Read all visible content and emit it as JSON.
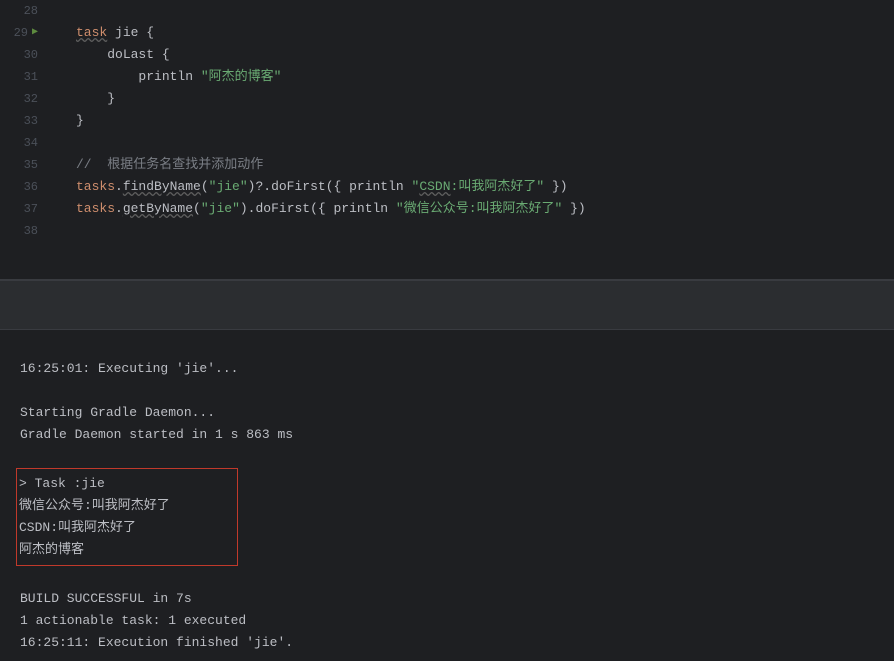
{
  "editor": {
    "lines": [
      {
        "num": "28",
        "content": ""
      },
      {
        "num": "29",
        "content": "task_jie",
        "hasRun": true
      },
      {
        "num": "30",
        "content": "doLast"
      },
      {
        "num": "31",
        "content": "println_blog"
      },
      {
        "num": "32",
        "content": "close_brace1"
      },
      {
        "num": "33",
        "content": "close_brace2"
      },
      {
        "num": "34",
        "content": ""
      },
      {
        "num": "35",
        "content": "comment"
      },
      {
        "num": "36",
        "content": "findByName"
      },
      {
        "num": "37",
        "content": "getByName"
      },
      {
        "num": "38",
        "content": ""
      }
    ],
    "tokens": {
      "task": "task",
      "jie": "jie",
      "doLast": "doLast",
      "println": "println",
      "blog_string": "\"阿杰的博客\"",
      "comment_text": "//  根据任务名查找并添加动作",
      "tasks": "tasks",
      "findByName": "findByName",
      "getByName": "getByName",
      "jie_string": "\"jie\"",
      "doFirst": "doFirst",
      "csdn_string": "\"CSDN:叫我阿杰好了\"",
      "csdn_prefix": "CSDN",
      "csdn_suffix": ":叫我阿杰好了",
      "wechat_string": "\"微信公众号:叫我阿杰好了\""
    }
  },
  "console": {
    "line1": "16:25:01: Executing 'jie'...",
    "line2": "",
    "line3": "Starting Gradle Daemon...",
    "line4": "Gradle Daemon started in 1 s 863 ms",
    "line5": "",
    "highlighted": {
      "h1": "> Task :jie",
      "h2": "微信公众号:叫我阿杰好了",
      "h3": "CSDN:叫我阿杰好了",
      "h4": "阿杰的博客"
    },
    "line6": "",
    "line7": "BUILD SUCCESSFUL in 7s",
    "line8": "1 actionable task: 1 executed",
    "line9": "16:25:11: Execution finished 'jie'."
  }
}
